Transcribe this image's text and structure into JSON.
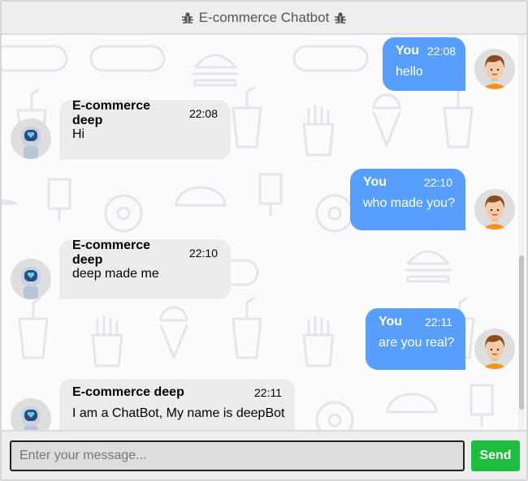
{
  "header": {
    "title": "E-commerce Chatbot"
  },
  "messages": [
    {
      "sender": "user",
      "name": "You",
      "time": "22:08",
      "text": "hello"
    },
    {
      "sender": "bot",
      "name": "E-commerce deep",
      "time": "22:08",
      "text": "Hi"
    },
    {
      "sender": "user",
      "name": "You",
      "time": "22:10",
      "text": "who made you?"
    },
    {
      "sender": "bot",
      "name": "E-commerce deep",
      "time": "22:10",
      "text": "deep made me"
    },
    {
      "sender": "user",
      "name": "You",
      "time": "22:11",
      "text": "are you real?"
    },
    {
      "sender": "bot",
      "name": "E-commerce deep",
      "time": "22:11",
      "text": "I am a ChatBot, My name is deepBot"
    }
  ],
  "composer": {
    "placeholder": "Enter your message...",
    "value": "",
    "send_label": "Send"
  },
  "colors": {
    "user_bubble": "#579ffb",
    "bot_bubble": "#ececec",
    "send_button": "#1ebd3f",
    "header_bg": "#eeeeee"
  }
}
